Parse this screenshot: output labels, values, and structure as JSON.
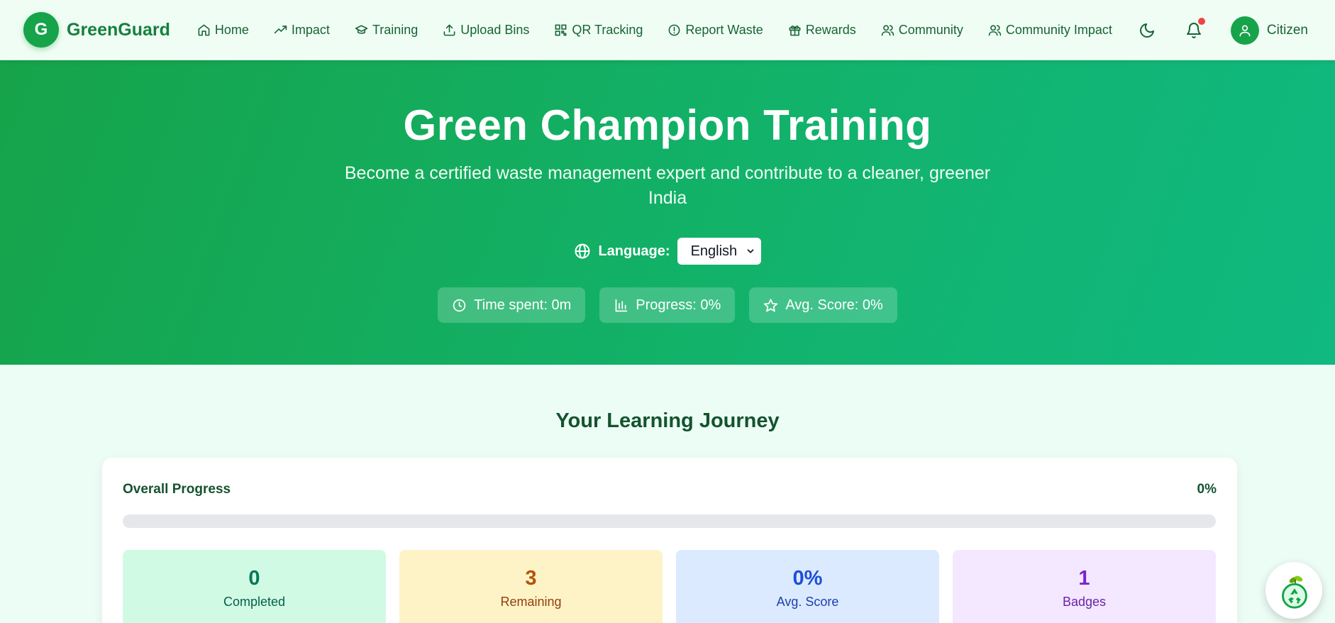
{
  "nav": {
    "logo_letter": "G",
    "brand": "GreenGuard",
    "items": [
      {
        "label": "Home",
        "icon": "home-icon"
      },
      {
        "label": "Impact",
        "icon": "trending-up-icon"
      },
      {
        "label": "Training",
        "icon": "graduation-cap-icon"
      },
      {
        "label": "Upload Bins",
        "icon": "upload-icon"
      },
      {
        "label": "QR Tracking",
        "icon": "qr-code-icon"
      },
      {
        "label": "Report Waste",
        "icon": "alert-circle-icon"
      },
      {
        "label": "Rewards",
        "icon": "gift-icon"
      },
      {
        "label": "Community",
        "icon": "users-icon"
      },
      {
        "label": "Community Impact",
        "icon": "users-icon"
      }
    ],
    "theme_icon": "moon-icon",
    "notification_icon": "bell-icon",
    "user_label": "Citizen"
  },
  "hero": {
    "title": "Green Champion Training",
    "subtitle": "Become a certified waste management expert and contribute to a cleaner, greener India",
    "language_label": "Language:",
    "language_selected": "English",
    "stats": {
      "time_spent": "Time spent: 0m",
      "progress": "Progress: 0%",
      "avg_score": "Avg. Score: 0%"
    }
  },
  "journey": {
    "title": "Your Learning Journey",
    "overall_label": "Overall Progress",
    "overall_value": "0%",
    "overall_fraction": 0,
    "tiles": [
      {
        "value": "0",
        "label": "Completed"
      },
      {
        "value": "3",
        "label": "Remaining"
      },
      {
        "value": "0%",
        "label": "Avg. Score"
      },
      {
        "value": "1",
        "label": "Badges"
      }
    ]
  },
  "colors": {
    "brand": "#16a34a",
    "hero_gradient_start": "#16a34a",
    "hero_gradient_end": "#10b981",
    "notification_dot": "#ef4444"
  },
  "fab_icon": "recycle-icon"
}
